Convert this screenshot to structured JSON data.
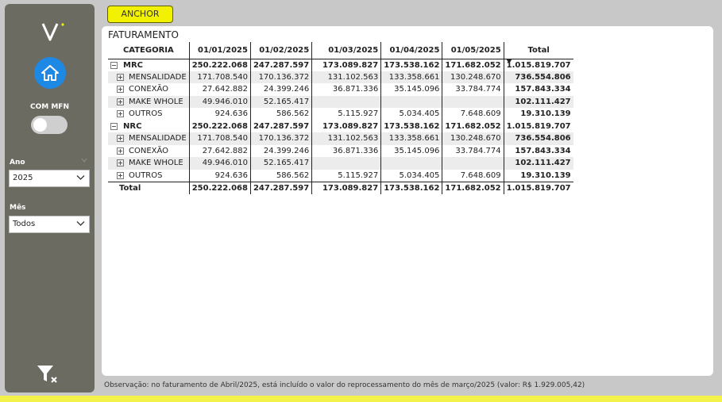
{
  "app": {
    "anchor_label": "ANCHOR"
  },
  "sidebar": {
    "toggle_label": "COM MFN",
    "ano_label": "Ano",
    "ano_value": "2025",
    "mes_label": "Mês",
    "mes_value": "Todos"
  },
  "report": {
    "title": "FATURAMENTO",
    "columns": [
      "CATEGORIA",
      "01/01/2025",
      "01/02/2025",
      "01/03/2025",
      "01/04/2025",
      "01/05/2025",
      "Total"
    ],
    "rows": [
      {
        "label": "MRC",
        "level": 0,
        "expanded": true,
        "values": [
          "250.222.068",
          "247.287.597",
          "173.089.827",
          "173.538.162",
          "171.682.052",
          "1.015.819.707"
        ]
      },
      {
        "label": "MENSALIDADE",
        "level": 1,
        "values": [
          "171.708.540",
          "170.136.372",
          "131.102.563",
          "133.358.661",
          "130.248.670",
          "736.554.806"
        ]
      },
      {
        "label": "CONEXÃO",
        "level": 1,
        "values": [
          "27.642.882",
          "24.399.246",
          "36.871.336",
          "35.145.096",
          "33.784.774",
          "157.843.334"
        ]
      },
      {
        "label": "MAKE WHOLE",
        "level": 1,
        "values": [
          "49.946.010",
          "52.165.417",
          "",
          "",
          "",
          "102.111.427"
        ]
      },
      {
        "label": "OUTROS",
        "level": 1,
        "values": [
          "924.636",
          "586.562",
          "5.115.927",
          "5.034.405",
          "7.648.609",
          "19.310.139"
        ]
      },
      {
        "label": "NRC",
        "level": 0,
        "expanded": true,
        "values": [
          "250.222.068",
          "247.287.597",
          "173.089.827",
          "173.538.162",
          "171.682.052",
          "1.015.819.707"
        ]
      },
      {
        "label": "MENSALIDADE",
        "level": 1,
        "values": [
          "171.708.540",
          "170.136.372",
          "131.102.563",
          "133.358.661",
          "130.248.670",
          "736.554.806"
        ]
      },
      {
        "label": "CONEXÃO",
        "level": 1,
        "values": [
          "27.642.882",
          "24.399.246",
          "36.871.336",
          "35.145.096",
          "33.784.774",
          "157.843.334"
        ]
      },
      {
        "label": "MAKE WHOLE",
        "level": 1,
        "values": [
          "49.946.010",
          "52.165.417",
          "",
          "",
          "",
          "102.111.427"
        ]
      },
      {
        "label": "OUTROS",
        "level": 1,
        "values": [
          "924.636",
          "586.562",
          "5.115.927",
          "5.034.405",
          "7.648.609",
          "19.310.139"
        ]
      }
    ],
    "total_row": {
      "label": "Total",
      "values": [
        "250.222.068",
        "247.287.597",
        "173.089.827",
        "173.538.162",
        "171.682.052",
        "1.015.819.707"
      ]
    }
  },
  "footer_note": "Observação: no faturamento de Abril/2025, está incluído o valor do reprocessamento do mês de março/2025 (valor: R$ 1.929.005,42)",
  "colors": {
    "accent_yellow": "#f2f200",
    "sidebar_bg": "#6c6b62",
    "home_blue": "#1e88e5"
  },
  "icons": [
    "logo-v-icon",
    "home-icon",
    "chevron-down-icon",
    "clear-filter-icon",
    "expand-icon",
    "collapse-icon",
    "sort-descending-icon"
  ]
}
